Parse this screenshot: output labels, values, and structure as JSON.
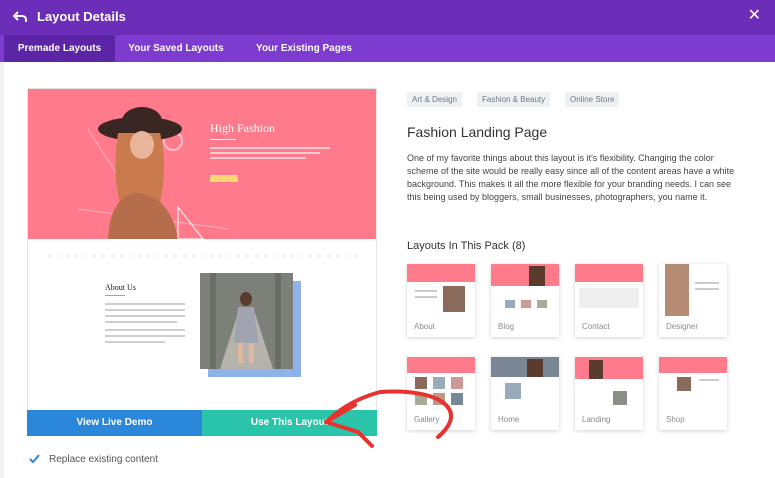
{
  "header": {
    "title": "Layout Details",
    "back_icon": "back-arrow-icon",
    "close_icon": "close-icon",
    "close_glyph": "✕",
    "background": "#6c2eb9"
  },
  "tabs": [
    {
      "label": "Premade Layouts",
      "active": true
    },
    {
      "label": "Your Saved Layouts",
      "active": false
    },
    {
      "label": "Your Existing Pages",
      "active": false
    }
  ],
  "preview": {
    "hero_title": "High Fashion",
    "about_title": "About Us",
    "accent_color": "#ff7b8c"
  },
  "actions": {
    "view_demo": "View Live Demo",
    "use_layout": "Use This Layout",
    "demo_color": "#2b87da",
    "use_color": "#29c4a9"
  },
  "replace_option": {
    "label": "Replace existing content",
    "checked": true
  },
  "details": {
    "tags": [
      "Art & Design",
      "Fashion & Beauty",
      "Online Store"
    ],
    "title": "Fashion Landing Page",
    "description": "One of my favorite things about this layout is it's flexibility. Changing the color scheme of the site would be really easy since all of the content areas have a white background. This makes it all the more flexible for your branding needs. I can see this being used by bloggers, small businesses, photographers, you name it.",
    "pack_heading": "Layouts In This Pack (8)"
  },
  "layouts": [
    {
      "label": "About"
    },
    {
      "label": "Blog"
    },
    {
      "label": "Contact"
    },
    {
      "label": "Designer"
    },
    {
      "label": "Gallery"
    },
    {
      "label": "Home"
    },
    {
      "label": "Landing"
    },
    {
      "label": "Shop"
    }
  ]
}
